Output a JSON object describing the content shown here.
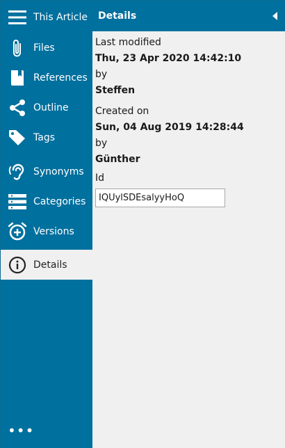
{
  "sidebar": {
    "items": [
      {
        "label": "This Article",
        "icon": "hamburger-menu-icon"
      },
      {
        "label": "Files",
        "icon": "paperclip-icon"
      },
      {
        "label": "References",
        "icon": "bookmark-book-icon"
      },
      {
        "label": "Outline",
        "icon": "share-nodes-icon"
      },
      {
        "label": "Tags",
        "icon": "tag-icon"
      },
      {
        "label": "Synonyms",
        "icon": "ear-icon"
      },
      {
        "label": "Categories",
        "icon": "list-stack-icon"
      },
      {
        "label": "Versions",
        "icon": "alarm-clock-plus-icon"
      },
      {
        "label": "Details",
        "icon": "info-circle-icon",
        "active": true
      }
    ],
    "more_label": "•••"
  },
  "panel": {
    "title": "Details",
    "last_modified_label": "Last modified",
    "last_modified_value": "Thu, 23 Apr 2020 14:42:10",
    "modified_by_label": "by",
    "modified_by_value": "Steffen",
    "created_label": "Created on",
    "created_value": "Sun, 04 Aug 2019 14:28:44",
    "created_by_label": "by",
    "created_by_value": "Günther",
    "id_label": "Id",
    "id_value": "IQUylSDEsalyyHoQ"
  },
  "colors": {
    "brand": "#00709e",
    "panel_bg": "#f0f0f0",
    "active_text": "#222222"
  }
}
